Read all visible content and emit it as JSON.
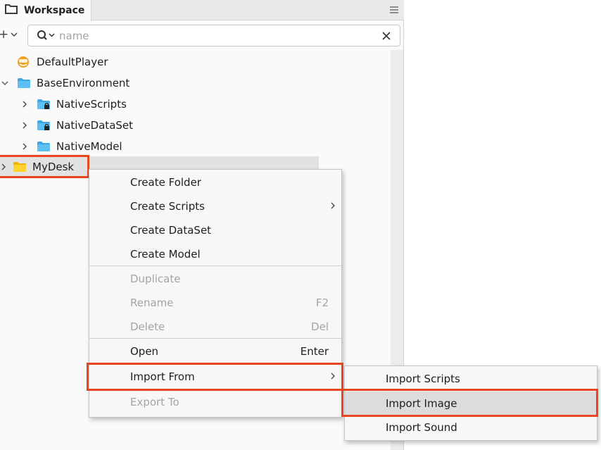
{
  "panel": {
    "tab_title": "Workspace",
    "add_label": "+",
    "search": {
      "placeholder": "name",
      "value": ""
    }
  },
  "tree": [
    {
      "label": "DefaultPlayer",
      "icon": "player-icon"
    },
    {
      "label": "BaseEnvironment",
      "icon": "folder-blue-icon",
      "expanded": true
    },
    {
      "label": "NativeScripts",
      "icon": "folder-locked-icon"
    },
    {
      "label": "NativeDataSet",
      "icon": "folder-locked-icon"
    },
    {
      "label": "NativeModel",
      "icon": "folder-blue-icon"
    },
    {
      "label": "MyDesk",
      "icon": "folder-yellow-icon",
      "selected": true
    }
  ],
  "context_menu": {
    "items": [
      {
        "label": "Create Folder"
      },
      {
        "label": "Create Scripts",
        "submenu": true
      },
      {
        "label": "Create DataSet"
      },
      {
        "label": "Create Model"
      },
      {
        "label": "Duplicate",
        "disabled": true
      },
      {
        "label": "Rename",
        "shortcut": "F2",
        "disabled": true
      },
      {
        "label": "Delete",
        "shortcut": "Del",
        "disabled": true
      },
      {
        "label": "Open",
        "shortcut": "Enter"
      },
      {
        "label": "Import From",
        "submenu": true
      },
      {
        "label": "Export To",
        "disabled": true
      }
    ]
  },
  "submenu": {
    "items": [
      {
        "label": "Import Scripts"
      },
      {
        "label": "Import Image",
        "hovered": true
      },
      {
        "label": "Import Sound"
      }
    ]
  },
  "colors": {
    "highlight": "#e8461e",
    "folder_blue": "#3aa7e6",
    "folder_yellow": "#f5c518"
  }
}
